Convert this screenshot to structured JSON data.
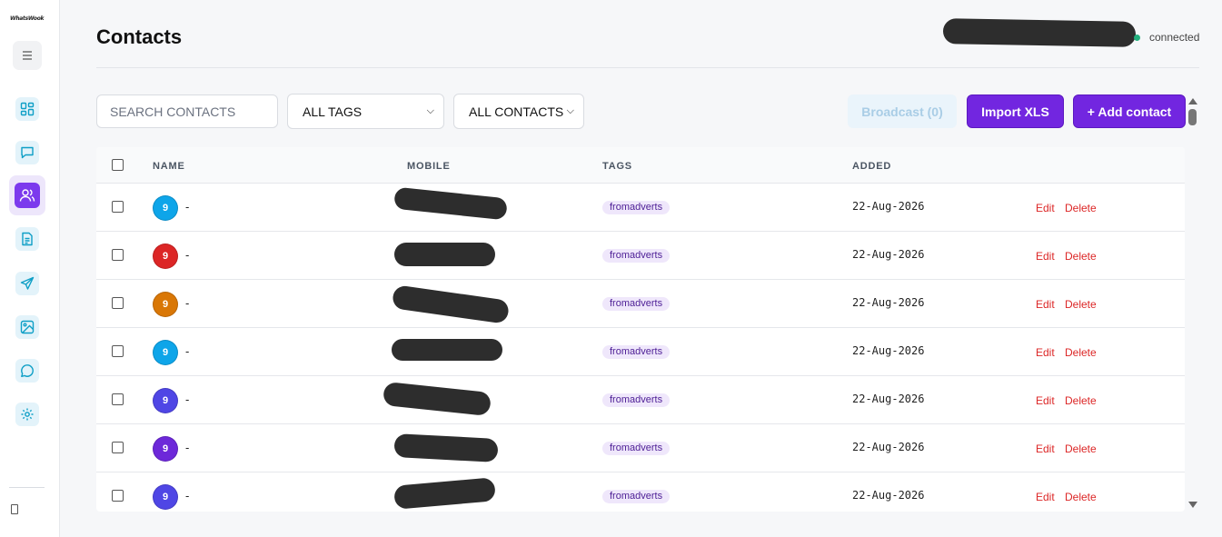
{
  "app": {
    "logo_text": "WhatsWook"
  },
  "sidebar": {
    "items": [
      {
        "name": "dashboard-icon",
        "active": false
      },
      {
        "name": "chat-icon",
        "active": false
      },
      {
        "name": "contacts-icon",
        "active": true
      },
      {
        "name": "document-icon",
        "active": false
      },
      {
        "name": "send-icon",
        "active": false
      },
      {
        "name": "image-icon",
        "active": false
      },
      {
        "name": "message-circle-icon",
        "active": false
      },
      {
        "name": "settings-icon",
        "active": false
      }
    ]
  },
  "header": {
    "title": "Contacts",
    "status": "connected",
    "status_color": "#22b07d"
  },
  "toolbar": {
    "search_placeholder": "SEARCH CONTACTS",
    "tag_filter": "ALL TAGS",
    "contact_filter": "ALL CONTACTS",
    "broadcast_label": "Broadcast (0)",
    "import_label": "Import XLS",
    "add_label": "+ Add contact"
  },
  "table": {
    "columns": {
      "name": "NAME",
      "mobile": "MOBILE",
      "tags": "TAGS",
      "added": "ADDED"
    },
    "rows": [
      {
        "avatar": "9",
        "avatar_color": "#0ea5e9",
        "name": "-",
        "tag": "fromadverts",
        "added": "22-Aug-2026",
        "edit": "Edit",
        "delete": "Delete"
      },
      {
        "avatar": "9",
        "avatar_color": "#dc2626",
        "name": "-",
        "tag": "fromadverts",
        "added": "22-Aug-2026",
        "edit": "Edit",
        "delete": "Delete"
      },
      {
        "avatar": "9",
        "avatar_color": "#d97706",
        "name": "-",
        "tag": "fromadverts",
        "added": "22-Aug-2026",
        "edit": "Edit",
        "delete": "Delete"
      },
      {
        "avatar": "9",
        "avatar_color": "#0ea5e9",
        "name": "-",
        "tag": "fromadverts",
        "added": "22-Aug-2026",
        "edit": "Edit",
        "delete": "Delete"
      },
      {
        "avatar": "9",
        "avatar_color": "#4f46e5",
        "name": "-",
        "tag": "fromadverts",
        "added": "22-Aug-2026",
        "edit": "Edit",
        "delete": "Delete"
      },
      {
        "avatar": "9",
        "avatar_color": "#6d28d9",
        "name": "-",
        "tag": "fromadverts",
        "added": "22-Aug-2026",
        "edit": "Edit",
        "delete": "Delete"
      },
      {
        "avatar": "9",
        "avatar_color": "#4f46e5",
        "name": "-",
        "tag": "fromadverts",
        "added": "22-Aug-2026",
        "edit": "Edit",
        "delete": "Delete"
      }
    ]
  },
  "colors": {
    "accent": "#7226e0",
    "danger": "#dc2626",
    "icon_bg": "#e3f3fa"
  }
}
